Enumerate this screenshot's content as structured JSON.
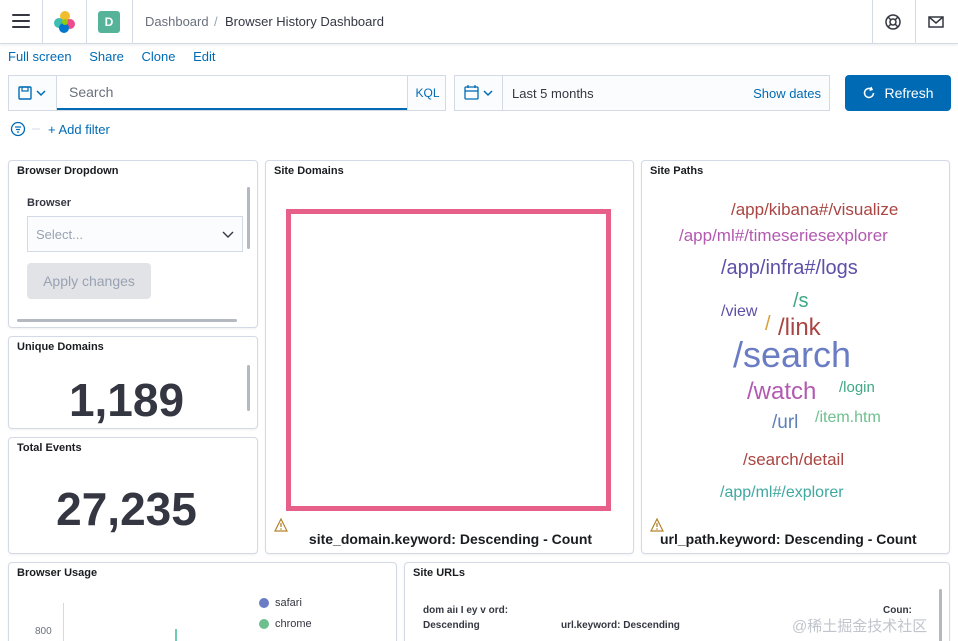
{
  "header": {
    "space_initial": "D",
    "breadcrumb_root": "Dashboard",
    "breadcrumb_separator": "/",
    "breadcrumb_current": "Browser History Dashboard"
  },
  "menu": {
    "full_screen": "Full screen",
    "share": "Share",
    "clone": "Clone",
    "edit": "Edit"
  },
  "query": {
    "placeholder": "Search",
    "language": "KQL"
  },
  "time": {
    "range": "Last 5 months",
    "show_dates": "Show dates"
  },
  "refresh_label": "Refresh",
  "filters": {
    "add_filter": "+ Add filter"
  },
  "panels": {
    "browser_dropdown": {
      "title": "Browser Dropdown",
      "field_label": "Browser",
      "select_placeholder": "Select...",
      "apply_label": "Apply changes"
    },
    "unique_domains": {
      "title": "Unique Domains",
      "value": "1,189"
    },
    "total_events": {
      "title": "Total Events",
      "value": "27,235"
    },
    "site_domains": {
      "title": "Site Domains",
      "caption": "site_domain.keyword: Descending - Count"
    },
    "site_paths": {
      "title": "Site Paths",
      "caption": "url_path.keyword: Descending - Count",
      "words": [
        {
          "text": "/app/kibana#/visualize",
          "color": "#a94542"
        },
        {
          "text": "/app/ml#/timeseriesexplorer",
          "color": "#b259b0"
        },
        {
          "text": "/app/infra#/logs",
          "color": "#5e4fa8"
        },
        {
          "text": "/s",
          "color": "#3fa884"
        },
        {
          "text": "/view",
          "color": "#5e4fa8"
        },
        {
          "text": "/",
          "color": "#d6a03a"
        },
        {
          "text": "/link",
          "color": "#a94542"
        },
        {
          "text": "/search",
          "color": "#6a7cc3"
        },
        {
          "text": "/watch",
          "color": "#b259b0"
        },
        {
          "text": "/login",
          "color": "#3fa884"
        },
        {
          "text": "/url",
          "color": "#5e7fb8"
        },
        {
          "text": "/item.htm",
          "color": "#6dc08e"
        },
        {
          "text": "/search/detail",
          "color": "#a94542"
        },
        {
          "text": "/app/ml#/explorer",
          "color": "#3fa8a0"
        }
      ]
    },
    "browser_usage": {
      "title": "Browser Usage",
      "y_tick": "800",
      "legend": [
        {
          "label": "safari",
          "color": "#6a7cc3"
        },
        {
          "label": "chrome",
          "color": "#6dc08e"
        }
      ]
    },
    "site_urls": {
      "title": "Site URLs",
      "col1_line1": "dom aiı I ey v ord:",
      "col1_line2": "Descending",
      "col2_line2": "url.keyword: Descending",
      "col3_line1": "Coun:"
    }
  },
  "watermark": "@稀土掘金技术社区"
}
